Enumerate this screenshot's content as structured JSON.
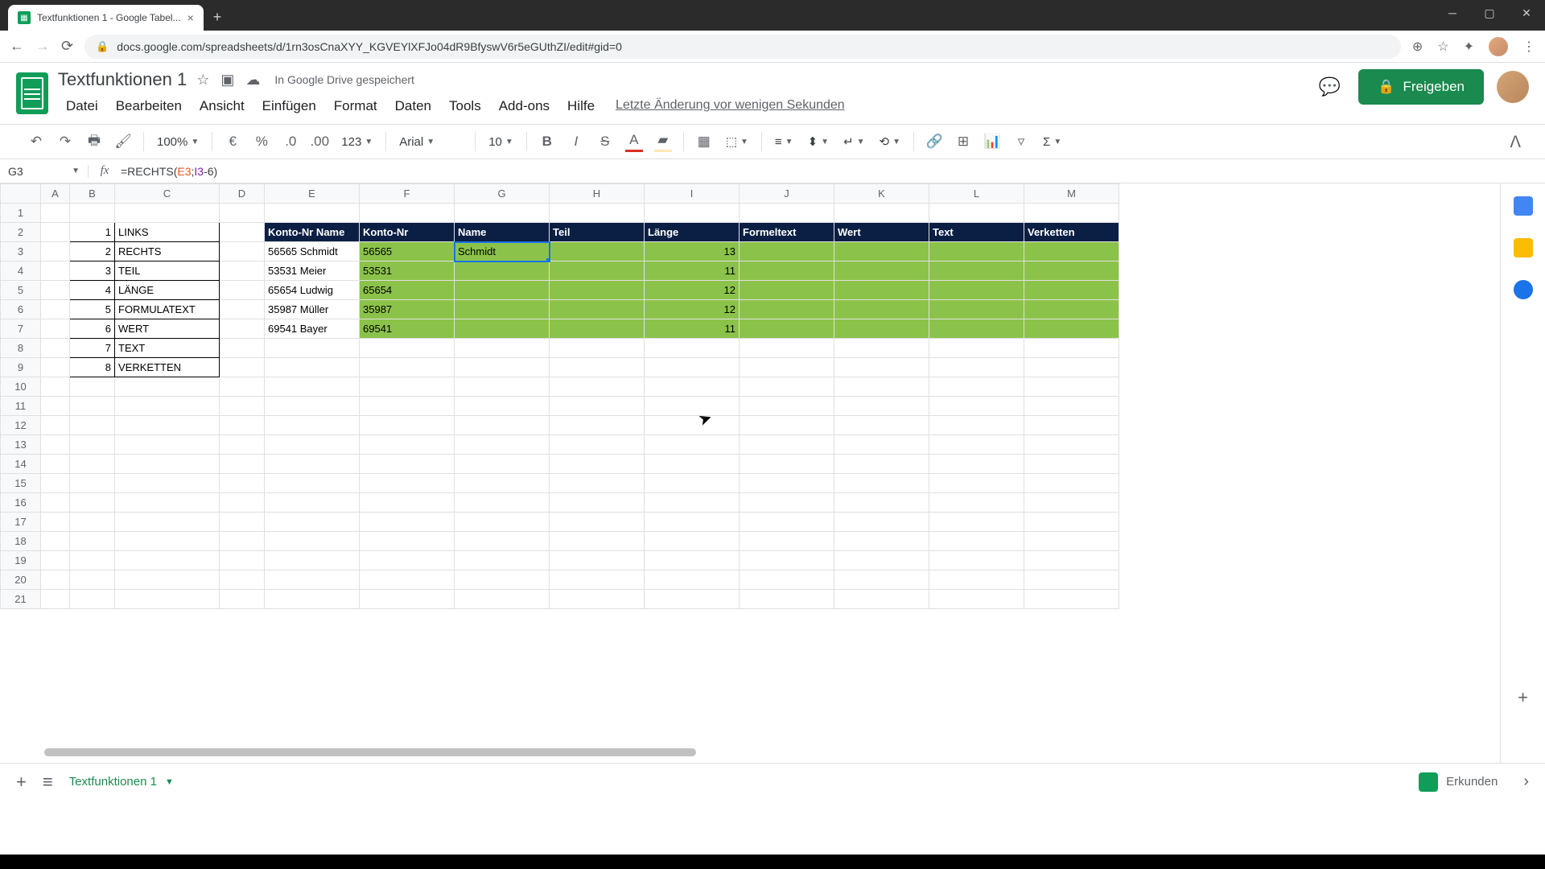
{
  "browser": {
    "tab_title": "Textfunktionen 1 - Google Tabel...",
    "url": "docs.google.com/spreadsheets/d/1rn3osCnaXYY_KGVEYlXFJo04dR9BfyswV6r5eGUthZI/edit#gid=0"
  },
  "doc": {
    "title": "Textfunktionen 1",
    "save_status": "In Google Drive gespeichert",
    "last_edit": "Letzte Änderung vor wenigen Sekunden",
    "share": "Freigeben"
  },
  "menus": [
    "Datei",
    "Bearbeiten",
    "Ansicht",
    "Einfügen",
    "Format",
    "Daten",
    "Tools",
    "Add-ons",
    "Hilfe"
  ],
  "toolbar": {
    "zoom": "100%",
    "format_num": "123",
    "font": "Arial",
    "font_size": "10"
  },
  "name_box": "G3",
  "formula": "=RECHTS(E3;I3-6)",
  "columns": [
    "A",
    "B",
    "C",
    "D",
    "E",
    "F",
    "G",
    "H",
    "I",
    "J",
    "K",
    "L",
    "M"
  ],
  "func_list": [
    {
      "n": "1",
      "name": "LINKS"
    },
    {
      "n": "2",
      "name": "RECHTS"
    },
    {
      "n": "3",
      "name": "TEIL"
    },
    {
      "n": "4",
      "name": "LÄNGE"
    },
    {
      "n": "5",
      "name": "FORMULATEXT"
    },
    {
      "n": "6",
      "name": "WERT"
    },
    {
      "n": "7",
      "name": "TEXT"
    },
    {
      "n": "8",
      "name": "VERKETTEN"
    }
  ],
  "headers": {
    "E": "Konto-Nr Name",
    "F": "Konto-Nr",
    "G": "Name",
    "H": "Teil",
    "I": "Länge",
    "J": "Formeltext",
    "K": "Wert",
    "L": "Text",
    "M": "Verketten"
  },
  "data_rows": [
    {
      "E": "56565 Schmidt",
      "F": "56565",
      "G": "Schmidt",
      "I": "13"
    },
    {
      "E": "53531 Meier",
      "F": "53531",
      "G": "",
      "I": "11"
    },
    {
      "E": "65654 Ludwig",
      "F": "65654",
      "G": "",
      "I": "12"
    },
    {
      "E": "35987 Müller",
      "F": "35987",
      "G": "",
      "I": "12"
    },
    {
      "E": "69541 Bayer",
      "F": "69541",
      "G": "",
      "I": "11"
    }
  ],
  "sheet_tab": "Textfunktionen 1",
  "explore": "Erkunden"
}
